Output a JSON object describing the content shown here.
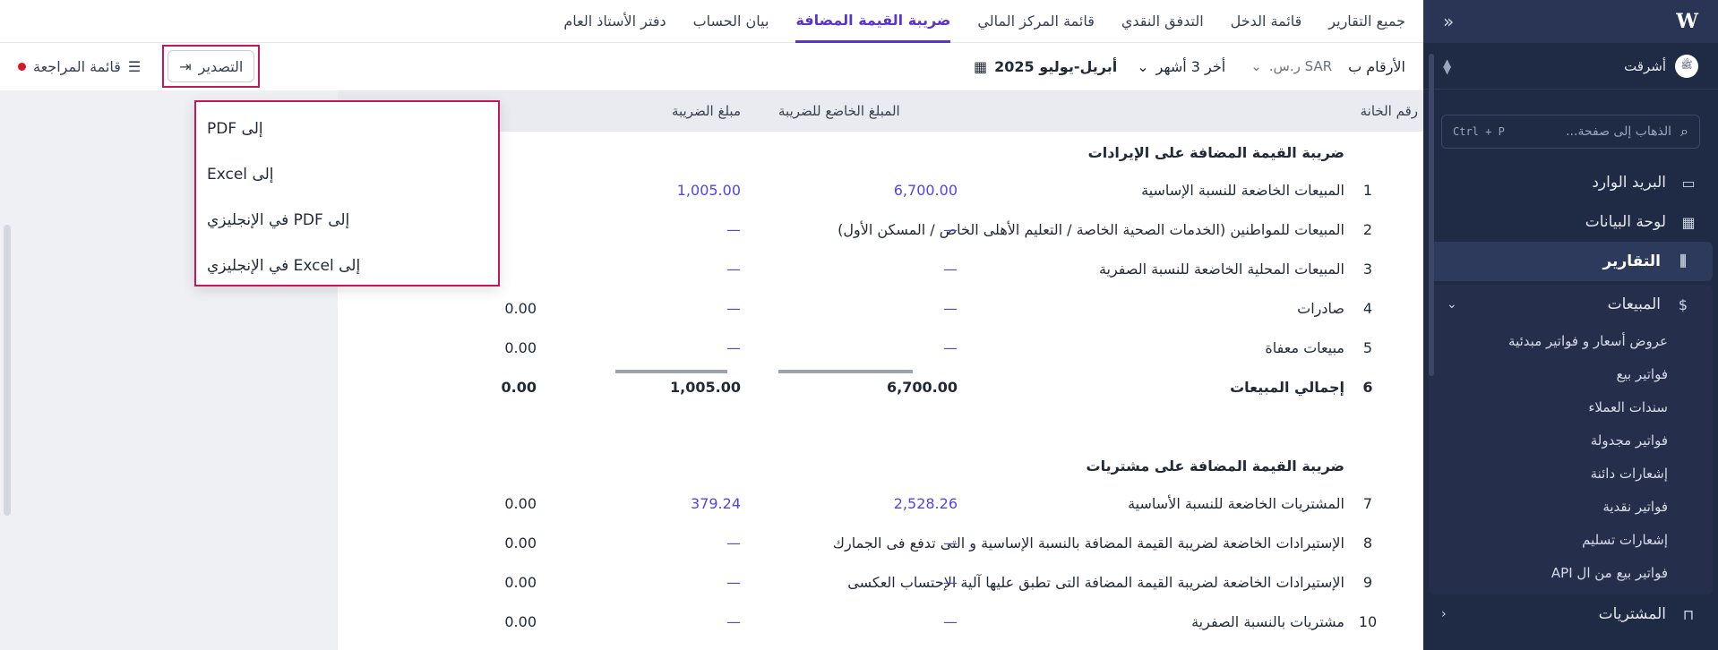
{
  "sidebar": {
    "logo": "W",
    "collapse_icon": "«",
    "org_name": "أشرقت",
    "org_avatar": "ﷺ",
    "search_placeholder": "الذهاب إلى صفحة...",
    "search_shortcut": "Ctrl + P",
    "items": [
      {
        "label": "البريد الوارد",
        "icon": "inbox-icon"
      },
      {
        "label": "لوحة البيانات",
        "icon": "grid-icon"
      },
      {
        "label": "التقارير",
        "icon": "chart-icon",
        "active": true
      },
      {
        "label": "المبيعات",
        "icon": "dollar-icon"
      }
    ],
    "sales_sub": [
      "عروض أسعار و فواتير مبدئية",
      "فواتير بيع",
      "سندات العملاء",
      "فواتير مجدولة",
      "إشعارات دائنة",
      "فواتير نقدية",
      "إشعارات تسليم",
      "فواتير بيع من ال API"
    ],
    "purchases_label": "المشتريات"
  },
  "tabs": [
    {
      "label": "جميع التقارير",
      "active": false
    },
    {
      "label": "قائمة الدخل",
      "active": false
    },
    {
      "label": "التدفق النقدي",
      "active": false
    },
    {
      "label": "قائمة المركز المالي",
      "active": false
    },
    {
      "label": "ضريبة القيمة المضافة",
      "active": true
    },
    {
      "label": "بيان الحساب",
      "active": false
    },
    {
      "label": "دفتر الأستاذ العام",
      "active": false
    }
  ],
  "toolbar": {
    "numbers_label": "الأرقام ب",
    "currency": "SAR ر.س.",
    "period": "أخر 3 أشهر",
    "range": "أبريل-يوليو 2025",
    "export_label": "التصدير",
    "review_label": "قائمة المراجعة"
  },
  "table": {
    "headers": {
      "num": "رقم الخانة",
      "taxable": "المبلغ الخاضع للضريبة",
      "tax": "مبلغ الضريبة"
    },
    "sections": [
      {
        "title": "ضريبة القيمة المضافة على الإيرادات",
        "rows": [
          {
            "num": "1",
            "desc": "المبيعات الخاضعة للنسبة الإساسية",
            "v1": "6,700.00",
            "v2": "1,005.00",
            "v3": ""
          },
          {
            "num": "2",
            "desc": "المبيعات للمواطنين (الخدمات الصحية الخاصة / التعليم الأهلى الخاص / المسكن الأول)",
            "v1": "—",
            "v2": "—",
            "v3": ""
          },
          {
            "num": "3",
            "desc": "المبيعات المحلية الخاضعة للنسبة الصفرية",
            "v1": "—",
            "v2": "—",
            "v3": ""
          },
          {
            "num": "4",
            "desc": "صادرات",
            "v1": "—",
            "v2": "—",
            "v3": "0.00"
          },
          {
            "num": "5",
            "desc": "مبيعات معفاة",
            "v1": "—",
            "v2": "—",
            "v3": "0.00"
          }
        ],
        "total": {
          "num": "6",
          "desc": "إجمالي المبيعات",
          "v1": "6,700.00",
          "v2": "1,005.00",
          "v3": "0.00"
        }
      },
      {
        "title": "ضريبة القيمة المضافة على مشتريات",
        "rows": [
          {
            "num": "7",
            "desc": "المشتريات الخاضعة للنسبة الأساسية",
            "v1": "2,528.26",
            "v2": "379.24",
            "v3": "0.00"
          },
          {
            "num": "8",
            "desc": "الإستيرادات الخاضعة لضريبة القيمة المضافة بالنسبة الإساسية و التى تدفع فى الجمارك",
            "v1": "—",
            "v2": "—",
            "v3": "0.00"
          },
          {
            "num": "9",
            "desc": "الإستيرادات الخاضعة لضريبة القيمة المضافة التى تطبق عليها آلية الإحتساب العكسى",
            "v1": "—",
            "v2": "—",
            "v3": "0.00"
          },
          {
            "num": "10",
            "desc": "مشتريات بالنسبة الصفرية",
            "v1": "—",
            "v2": "—",
            "v3": "0.00"
          }
        ]
      }
    ]
  },
  "export_menu": [
    "إلى PDF",
    "إلى Excel",
    "إلى PDF في الإنجليزي",
    "إلى Excel في الإنجليزي"
  ],
  "colors": {
    "accent": "#5a35c9",
    "highlight": "#c2185b",
    "sidebar": "#1f2a44",
    "value_blue": "#4f46e5"
  }
}
